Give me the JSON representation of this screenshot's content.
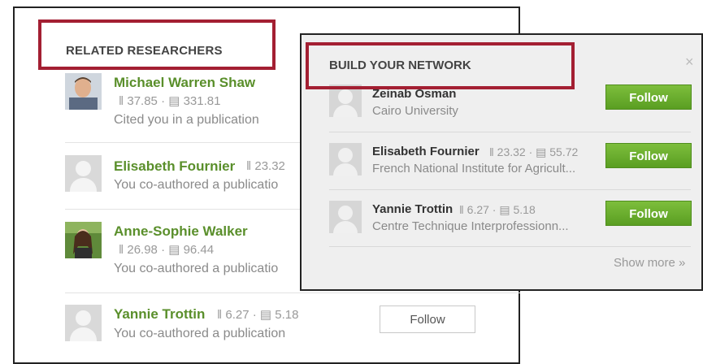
{
  "related": {
    "title": "RELATED RESEARCHERS",
    "items": [
      {
        "name": "Michael Warren Shaw",
        "stats": "‖ 37.85 · ▤ 331.81",
        "desc": "Cited you in a publication",
        "avatar": "photo"
      },
      {
        "name": "Elisabeth Fournier",
        "stats": "‖ 23.32",
        "desc": "You co-authored a publicatio",
        "avatar": "default"
      },
      {
        "name": "Anne-Sophie Walker",
        "stats": "‖ 26.98 · ▤ 96.44",
        "desc": "You co-authored a publicatio",
        "avatar": "photo"
      },
      {
        "name": "Yannie Trottin",
        "stats": "‖ 6.27 · ▤ 5.18",
        "desc": "You co-authored a publication",
        "avatar": "default"
      }
    ],
    "follow_label": "Follow"
  },
  "network": {
    "title": "BUILD YOUR NETWORK",
    "close": "×",
    "items": [
      {
        "name": "Zeinab Osman",
        "stats": "",
        "affiliation": "Cairo University",
        "follow": "Follow"
      },
      {
        "name": "Elisabeth Fournier",
        "stats": "‖ 23.32 · ▤ 55.72",
        "affiliation": "French National Institute for Agricult...",
        "follow": "Follow"
      },
      {
        "name": "Yannie Trottin",
        "stats": "‖ 6.27 · ▤ 5.18",
        "affiliation": "Centre Technique Interprofessionn...",
        "follow": "Follow"
      }
    ],
    "show_more": "Show more »"
  },
  "colors": {
    "name_green": "#5a8f2b",
    "follow_green": "#6cb12f",
    "highlight": "#a31f32"
  }
}
